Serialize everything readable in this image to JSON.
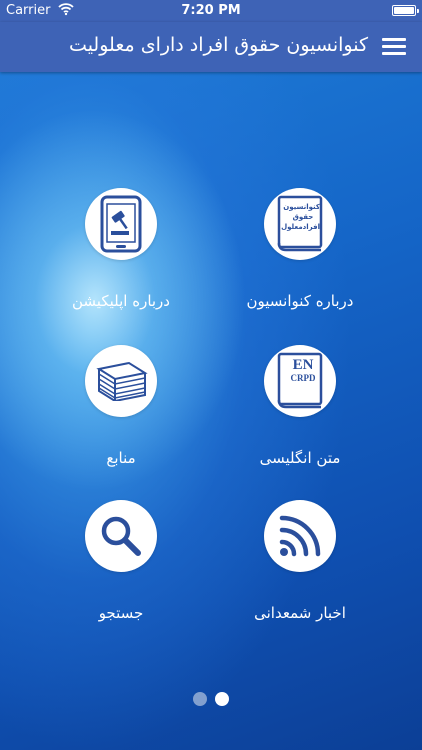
{
  "status_bar": {
    "carrier": "Carrier",
    "time": "7:20 PM"
  },
  "nav": {
    "title": "کنوانسیون حقوق افراد دارای معلولیت",
    "menu_icon": "hamburger-icon"
  },
  "tiles": [
    {
      "label": "درباره کنوانسیون",
      "icon": "book-icon",
      "book_lines": [
        "کنوانسیون",
        "حقوق",
        "افرادمعلول"
      ]
    },
    {
      "label": "درباره اپلیکیشن",
      "icon": "tablet-gavel-icon"
    },
    {
      "label": "متن انگلیسی",
      "icon": "english-book-icon",
      "book_lines": [
        "EN",
        "CRPD"
      ]
    },
    {
      "label": "منابع",
      "icon": "paper-stack-icon"
    },
    {
      "label": "اخبار شمعدانی",
      "icon": "rss-icon"
    },
    {
      "label": "جستجو",
      "icon": "search-icon"
    }
  ],
  "pager": {
    "pages": 2,
    "active": 2
  },
  "colors": {
    "bar": "#3e63b6",
    "icon": "#2b4f9c",
    "background": "#1566c8"
  }
}
